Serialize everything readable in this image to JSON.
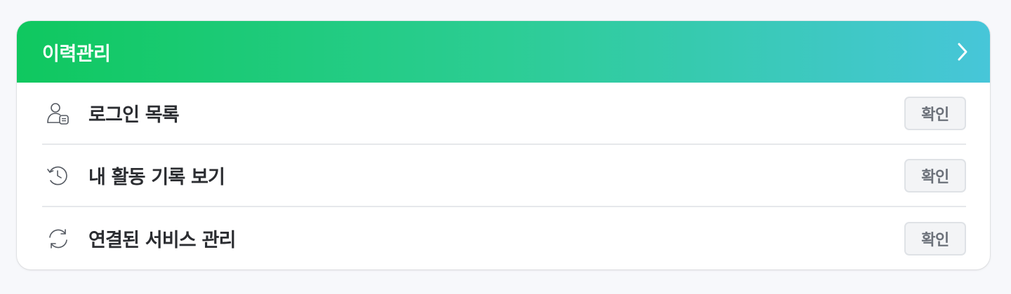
{
  "card": {
    "title": "이력관리",
    "header_icon": "chevron-right-icon",
    "gradient": [
      "#0fc85f",
      "#2ccd94",
      "#47c6d9"
    ]
  },
  "items": [
    {
      "label": "로그인 목록",
      "icon": "user-list-icon",
      "button": "확인"
    },
    {
      "label": "내 활동 기록 보기",
      "icon": "history-icon",
      "button": "확인"
    },
    {
      "label": "연결된 서비스 관리",
      "icon": "sync-icon",
      "button": "확인"
    }
  ]
}
